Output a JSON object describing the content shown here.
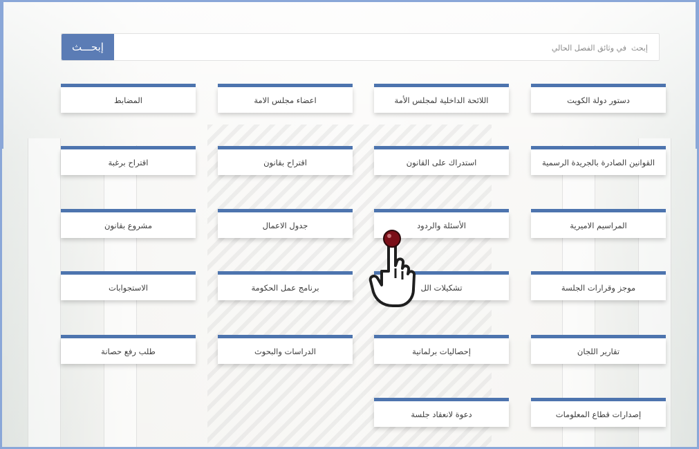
{
  "search": {
    "button_label": "إبحـــث",
    "placeholder": "إبحث  في وثائق الفصل الحالي"
  },
  "tiles": [
    [
      "دستور دولة الكويت",
      "اللائحة الداخلية لمجلس الأمة",
      "اعضاء مجلس الامة",
      "المضابط"
    ],
    [
      "القوانين الصادرة بالجريدة الرسمية",
      "استدراك على القانون",
      "اقتراح بقانون",
      "اقتراح برغبة"
    ],
    [
      "المراسيم الاميرية",
      "الأسئلة والردود",
      "جدول الاعمال",
      "مشروع بقانون"
    ],
    [
      "موجز وقرارات الجلسة",
      "تشكيلات الل",
      "برنامج عمل الحكومة",
      "الاستجوابات"
    ],
    [
      "تقارير اللجان",
      "إحصاليات برلمانية",
      "الدراسات والبحوث",
      "طلب رفع حصانة"
    ],
    [
      "إصدارات قطاع المعلومات",
      "دعوة لانعقاد جلسة"
    ]
  ],
  "icons": {
    "cursor": "hand-pointer-icon"
  },
  "colors": {
    "accent": "#4d74ae",
    "button": "#5b7cb5",
    "frame": "#8aa7d8"
  }
}
